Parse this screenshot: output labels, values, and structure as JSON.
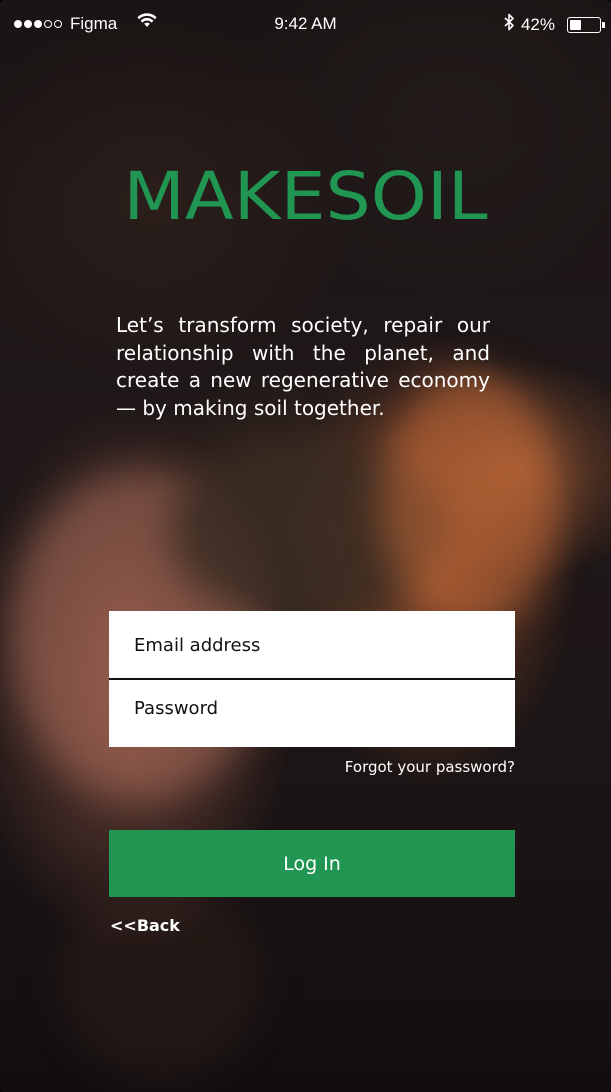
{
  "status_bar": {
    "carrier": "Figma",
    "signal_bars_filled": 3,
    "signal_bars_total": 5,
    "time": "9:42 AM",
    "battery_percent_label": "42%",
    "battery_level": 0.42,
    "icons": [
      "signal-dots-icon",
      "wifi-icon",
      "bluetooth-icon",
      "battery-icon"
    ]
  },
  "brand": {
    "logo_text": "MAKESOIL",
    "accent_color": "#219653"
  },
  "tagline": "Let’s transform society, repair our relationship with the planet, and create a new regenerative economy — by making soil together.",
  "form": {
    "email_placeholder": "Email address",
    "password_placeholder": "Password",
    "forgot_label": "Forgot your password?",
    "login_label": "Log In"
  },
  "nav": {
    "back_label": "<<Back"
  }
}
